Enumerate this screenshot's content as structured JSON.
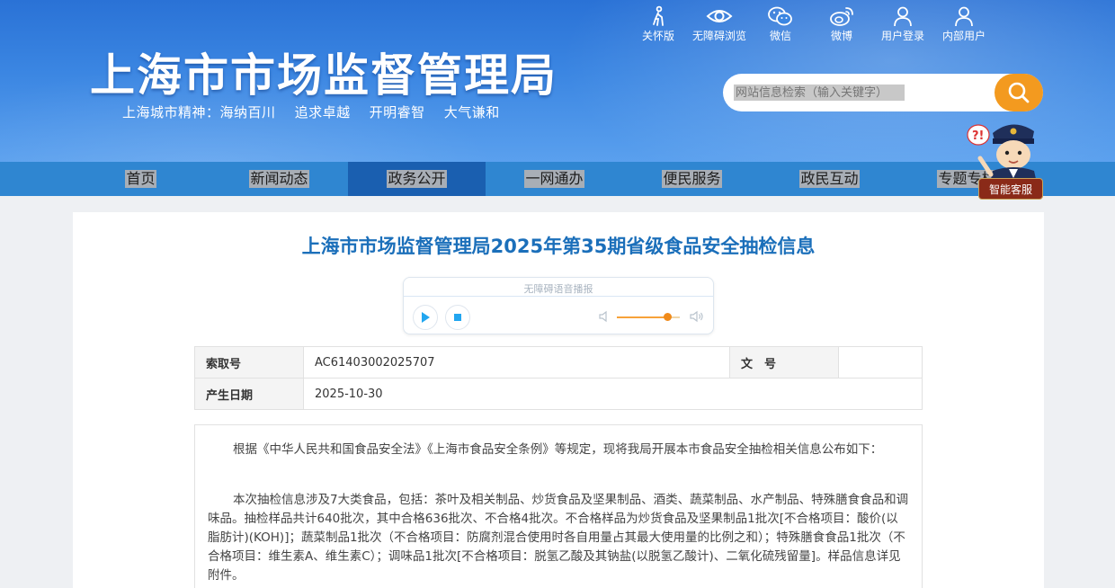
{
  "header": {
    "site_title": "上海市市场监督管理局",
    "slogan": "上海城市精神：海纳百川    追求卓越    开明睿智    大气谦和",
    "top_links": [
      {
        "label": "关怀版",
        "icon": "elder-care-icon"
      },
      {
        "label": "无障碍浏览",
        "icon": "eye-icon"
      },
      {
        "label": "微信",
        "icon": "wechat-icon"
      },
      {
        "label": "微博",
        "icon": "weibo-icon"
      },
      {
        "label": "用户登录",
        "icon": "user-icon"
      },
      {
        "label": "内部用户",
        "icon": "user-icon"
      }
    ],
    "search": {
      "placeholder": "网站信息检索（输入关键字）",
      "icon": "search-icon"
    }
  },
  "nav": {
    "items": [
      {
        "label": "首页",
        "active": false
      },
      {
        "label": "新闻动态",
        "active": false
      },
      {
        "label": "政务公开",
        "active": true
      },
      {
        "label": "一网通办",
        "active": false
      },
      {
        "label": "便民服务",
        "active": false
      },
      {
        "label": "政民互动",
        "active": false
      },
      {
        "label": "专题专栏",
        "active": false
      }
    ]
  },
  "assistant": {
    "label": "智能客服",
    "icon": "police-assistant-icon"
  },
  "article": {
    "title": "上海市市场监督管理局2025年第35期省级食品安全抽检信息",
    "player": {
      "label": "无障碍语音播报",
      "volume": 0.8
    },
    "meta": {
      "index_label": "索取号",
      "index_value": "AC61403002025707",
      "docno_label": "文　号",
      "docno_value": "",
      "date_label": "产生日期",
      "date_value": "2025-10-30"
    },
    "paragraphs": [
      "根据《中华人民共和国食品安全法》《上海市食品安全条例》等规定，现将我局开展本市食品安全抽检相关信息公布如下：",
      "本次抽检信息涉及7大类食品，包括：茶叶及相关制品、炒货食品及坚果制品、酒类、蔬菜制品、水产制品、特殊膳食食品和调味品。抽检样品共计640批次，其中合格636批次、不合格4批次。不合格样品为炒货食品及坚果制品1批次[不合格项目：酸价(以脂肪计)(KOH)]；蔬菜制品1批次（不合格项目：防腐剂混合使用时各自用量占其最大使用量的比例之和）；特殊膳食食品1批次（不合格项目：维生素A、维生素C）；调味品1批次[不合格项目：脱氢乙酸及其钠盐(以脱氢乙酸计)、二氧化硫残留量]。样品信息详见附件。"
    ]
  },
  "colors": {
    "header_blue": "#3b86e2",
    "nav_blue": "#2f86d1",
    "nav_active": "#1a5fb0",
    "title_blue": "#1b6fba",
    "search_orange": "#f39a1f"
  }
}
